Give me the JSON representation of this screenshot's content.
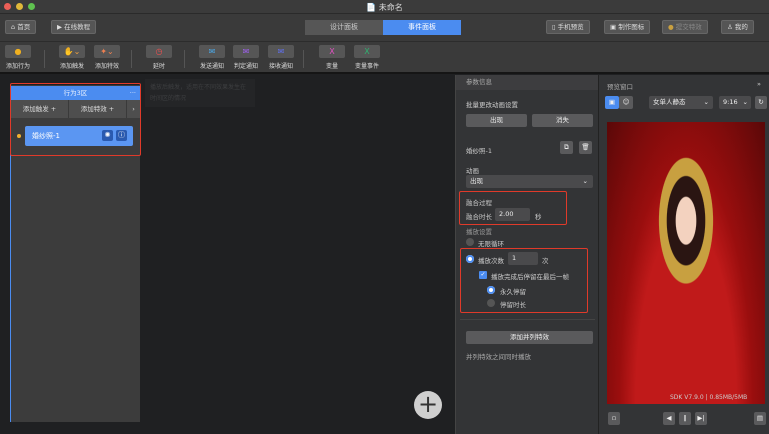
{
  "window": {
    "title": "未命名",
    "colors": {
      "close": "#ec5f57",
      "min": "#e0b83a",
      "max": "#5fc24f",
      "accent": "#4b8cf0"
    }
  },
  "topbar": {
    "home": "首页",
    "tutorial": "在线教程",
    "tabs": [
      "设计面板",
      "事件面板"
    ],
    "active_tab": "事件面板",
    "phone_preview": "手机预览",
    "make_icon": "制作图标",
    "submit": "提交特效",
    "mine": "我的"
  },
  "tools": [
    {
      "label": "添加行为",
      "icon": "plus-circle-icon"
    },
    {
      "label": "添加触发",
      "icon": "hand-icon"
    },
    {
      "label": "添加特效",
      "icon": "magic-wand-icon"
    },
    {
      "label": "延时",
      "icon": "timer-icon"
    },
    {
      "label": "发送通知",
      "icon": "send-notice-icon"
    },
    {
      "label": "判定通知",
      "icon": "judge-notice-icon"
    },
    {
      "label": "接收通知",
      "icon": "receive-notice-icon"
    },
    {
      "label": "变量",
      "icon": "variable-icon"
    },
    {
      "label": "变量事件",
      "icon": "variable-event-icon"
    }
  ],
  "track": {
    "title": "行为3区",
    "more": "···",
    "add_trigger": "添加触发 +",
    "add_effect": "添加特效 +",
    "next": "›",
    "clip_name": "婚纱照-1"
  },
  "tooltip": "播放后触发，适用在不同效果发生在时间区的情况",
  "props": {
    "header": "参数信息",
    "batch_label": "批量更改动画设置",
    "appear": "出现",
    "disappear": "消失",
    "item_name": "婚纱照-1",
    "animation_label": "动画",
    "animation_value": "出现",
    "fusion_title": "融合过程",
    "fusion_duration_label": "融合时长",
    "fusion_duration": "2.00",
    "seconds": "秒",
    "play_settings": "播放设置",
    "infinite_loop": "无限循环",
    "play_count_label": "播放次数",
    "play_count": "1",
    "times": "次",
    "stay_last_frame": "播放完成后停留在最后一帧",
    "stay_forever": "永久停留",
    "stay_duration": "停留时长",
    "add_parallel": "添加并列特效",
    "parallel_hint": "并列特效之间同时播放"
  },
  "preview": {
    "header": "预览窗口",
    "model": "女单人静态",
    "ratio": "9:16",
    "sdk": "SDK V7.9.0 | 0.85MB/5MB"
  }
}
